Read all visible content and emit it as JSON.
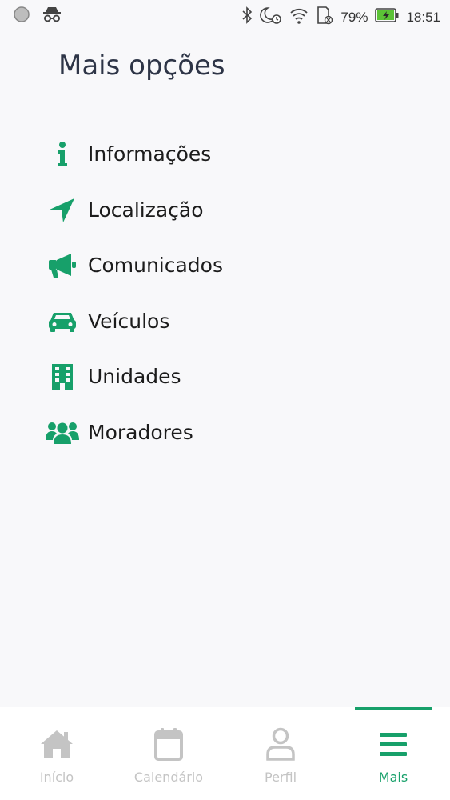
{
  "status_bar": {
    "battery": "79%",
    "time": "18:51"
  },
  "page": {
    "title": "Mais opções"
  },
  "menu": {
    "items": [
      {
        "label": "Informações",
        "icon": "info-icon"
      },
      {
        "label": "Localização",
        "icon": "location-arrow-icon"
      },
      {
        "label": "Comunicados",
        "icon": "megaphone-icon"
      },
      {
        "label": "Veículos",
        "icon": "car-icon"
      },
      {
        "label": "Unidades",
        "icon": "building-icon"
      },
      {
        "label": "Moradores",
        "icon": "users-icon"
      }
    ]
  },
  "bottom_nav": {
    "items": [
      {
        "label": "Início",
        "icon": "home-icon",
        "active": false
      },
      {
        "label": "Calendário",
        "icon": "calendar-icon",
        "active": false
      },
      {
        "label": "Perfil",
        "icon": "user-icon",
        "active": false
      },
      {
        "label": "Mais",
        "icon": "menu-icon",
        "active": true
      }
    ]
  },
  "colors": {
    "accent": "#17a06a",
    "inactive": "#c4c4c4",
    "title": "#2e3547"
  }
}
